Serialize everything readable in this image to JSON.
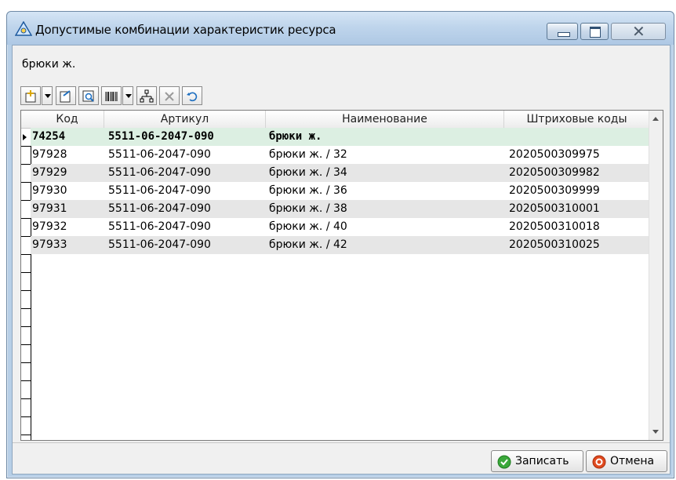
{
  "window": {
    "title": "Допустимые комбинации характеристик ресурса"
  },
  "subtitle": "брюки ж.",
  "grid": {
    "columns": [
      "Код",
      "Артикул",
      "Наименование",
      "Штриховые коды"
    ],
    "rows": [
      {
        "code": "74254",
        "article": "5511-06-2047-090",
        "name": "брюки ж.",
        "barcode": ""
      },
      {
        "code": "97928",
        "article": "5511-06-2047-090",
        "name": "брюки ж.  / 32",
        "barcode": "2020500309975"
      },
      {
        "code": "97929",
        "article": "5511-06-2047-090",
        "name": "брюки ж.  / 34",
        "barcode": "2020500309982"
      },
      {
        "code": "97930",
        "article": "5511-06-2047-090",
        "name": "брюки ж.  / 36",
        "barcode": "2020500309999"
      },
      {
        "code": "97931",
        "article": "5511-06-2047-090",
        "name": "брюки ж.  / 38",
        "barcode": "2020500310001"
      },
      {
        "code": "97932",
        "article": "5511-06-2047-090",
        "name": "брюки ж.  / 40",
        "barcode": "2020500310018"
      },
      {
        "code": "97933",
        "article": "5511-06-2047-090",
        "name": "брюки ж.  / 42",
        "barcode": "2020500310025"
      }
    ]
  },
  "buttons": {
    "save": "Записать",
    "cancel": "Отмена"
  },
  "colors": {
    "selected_row": "#dcefe2",
    "alt_row": "#e6e6e6",
    "save_icon": "#3aa83a",
    "cancel_icon": "#e04a1f"
  }
}
